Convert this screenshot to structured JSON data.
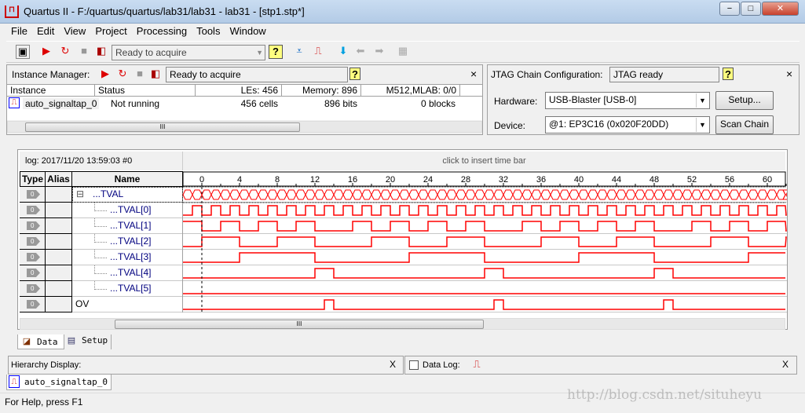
{
  "window": {
    "title": "Quartus II - F:/quartus/quartus/lab31/lab31 - lab31 - [stp1.stp*]",
    "minimize": "−",
    "maximize": "□",
    "close": "✕"
  },
  "menu": [
    "File",
    "Edit",
    "View",
    "Project",
    "Processing",
    "Tools",
    "Window"
  ],
  "toolbar": {
    "status_combo": "Ready to acquire"
  },
  "instance_manager": {
    "label": "Instance Manager:",
    "status": "Ready to acquire",
    "close": "×",
    "columns": [
      "Instance",
      "Status",
      "LEs: 456",
      "Memory: 896",
      "M512,MLAB: 0/0"
    ],
    "rows": [
      {
        "instance": "auto_signaltap_0",
        "status": "Not running",
        "les": "456 cells",
        "memory": "896 bits",
        "m512": "0 blocks"
      }
    ],
    "scroll_grip": "III"
  },
  "jtag": {
    "label": "JTAG Chain Configuration:",
    "status": "JTAG ready",
    "close": "×",
    "hardware_label": "Hardware:",
    "hardware_value": "USB-Blaster [USB-0]",
    "setup_button": "Setup...",
    "device_label": "Device:",
    "device_value": "@1: EP3C16 (0x020F20DD)",
    "scan_button": "Scan Chain"
  },
  "waveform": {
    "log": "log: 2017/11/20 13:59:03  #0",
    "time_bar_hint": "click to insert time bar",
    "columns": {
      "type": "Type",
      "alias": "Alias",
      "name": "Name"
    },
    "signals": [
      {
        "name": "...TVAL",
        "kind": "bus",
        "expander": "⊟"
      },
      {
        "name": "...TVAL[0]",
        "kind": "bit",
        "bit": 0
      },
      {
        "name": "...TVAL[1]",
        "kind": "bit",
        "bit": 1
      },
      {
        "name": "...TVAL[2]",
        "kind": "bit",
        "bit": 2
      },
      {
        "name": "...TVAL[3]",
        "kind": "bit",
        "bit": 3
      },
      {
        "name": "...TVAL[4]",
        "kind": "bit",
        "bit": 4
      },
      {
        "name": "...TVAL[5]",
        "kind": "bit",
        "bit": 5
      },
      {
        "name": "OV",
        "kind": "ov"
      }
    ],
    "type_icon_text": "0",
    "scroll_grip": "III",
    "wave_color": "#ff0000"
  },
  "chart_data": {
    "type": "waveform",
    "x_ticks": [
      "0",
      "4",
      "8",
      "12",
      "16",
      "20",
      "24",
      "28",
      "32",
      "36",
      "40",
      "44",
      "48",
      "52",
      "56",
      "60"
    ],
    "trigger_sample": 0,
    "x_start": -2,
    "tval": [
      2,
      3,
      4,
      5,
      6,
      7,
      8,
      9,
      10,
      11,
      12,
      13,
      14,
      15,
      16,
      17,
      0,
      1,
      2,
      3,
      4,
      5,
      6,
      7,
      8,
      9,
      10,
      11,
      12,
      13,
      14,
      15,
      16,
      17,
      0,
      1,
      2,
      3,
      4,
      5,
      6,
      7,
      8,
      9,
      10,
      11,
      12,
      13,
      14,
      15,
      16,
      17,
      0,
      1,
      2,
      3,
      4,
      5,
      6,
      7,
      8,
      9,
      10,
      11,
      12
    ],
    "ov": [
      0,
      0,
      0,
      0,
      0,
      0,
      0,
      0,
      0,
      0,
      0,
      0,
      0,
      0,
      0,
      1,
      0,
      0,
      0,
      0,
      0,
      0,
      0,
      0,
      0,
      0,
      0,
      0,
      0,
      0,
      0,
      0,
      0,
      1,
      0,
      0,
      0,
      0,
      0,
      0,
      0,
      0,
      0,
      0,
      0,
      0,
      0,
      0,
      0,
      0,
      0,
      1,
      0,
      0,
      0,
      0,
      0,
      0,
      0,
      0,
      0,
      0,
      0,
      0,
      0
    ]
  },
  "tabs": [
    {
      "label": "Data"
    },
    {
      "label": "Setup"
    }
  ],
  "hierarchy": {
    "label": "Hierarchy Display:",
    "close": "X"
  },
  "datalog": {
    "label": "Data Log:",
    "close": "X"
  },
  "instance_tab": "auto_signaltap_0",
  "statusbar": {
    "text": "For Help, press F1"
  },
  "watermark": "http://blog.csdn.net/situheyu"
}
